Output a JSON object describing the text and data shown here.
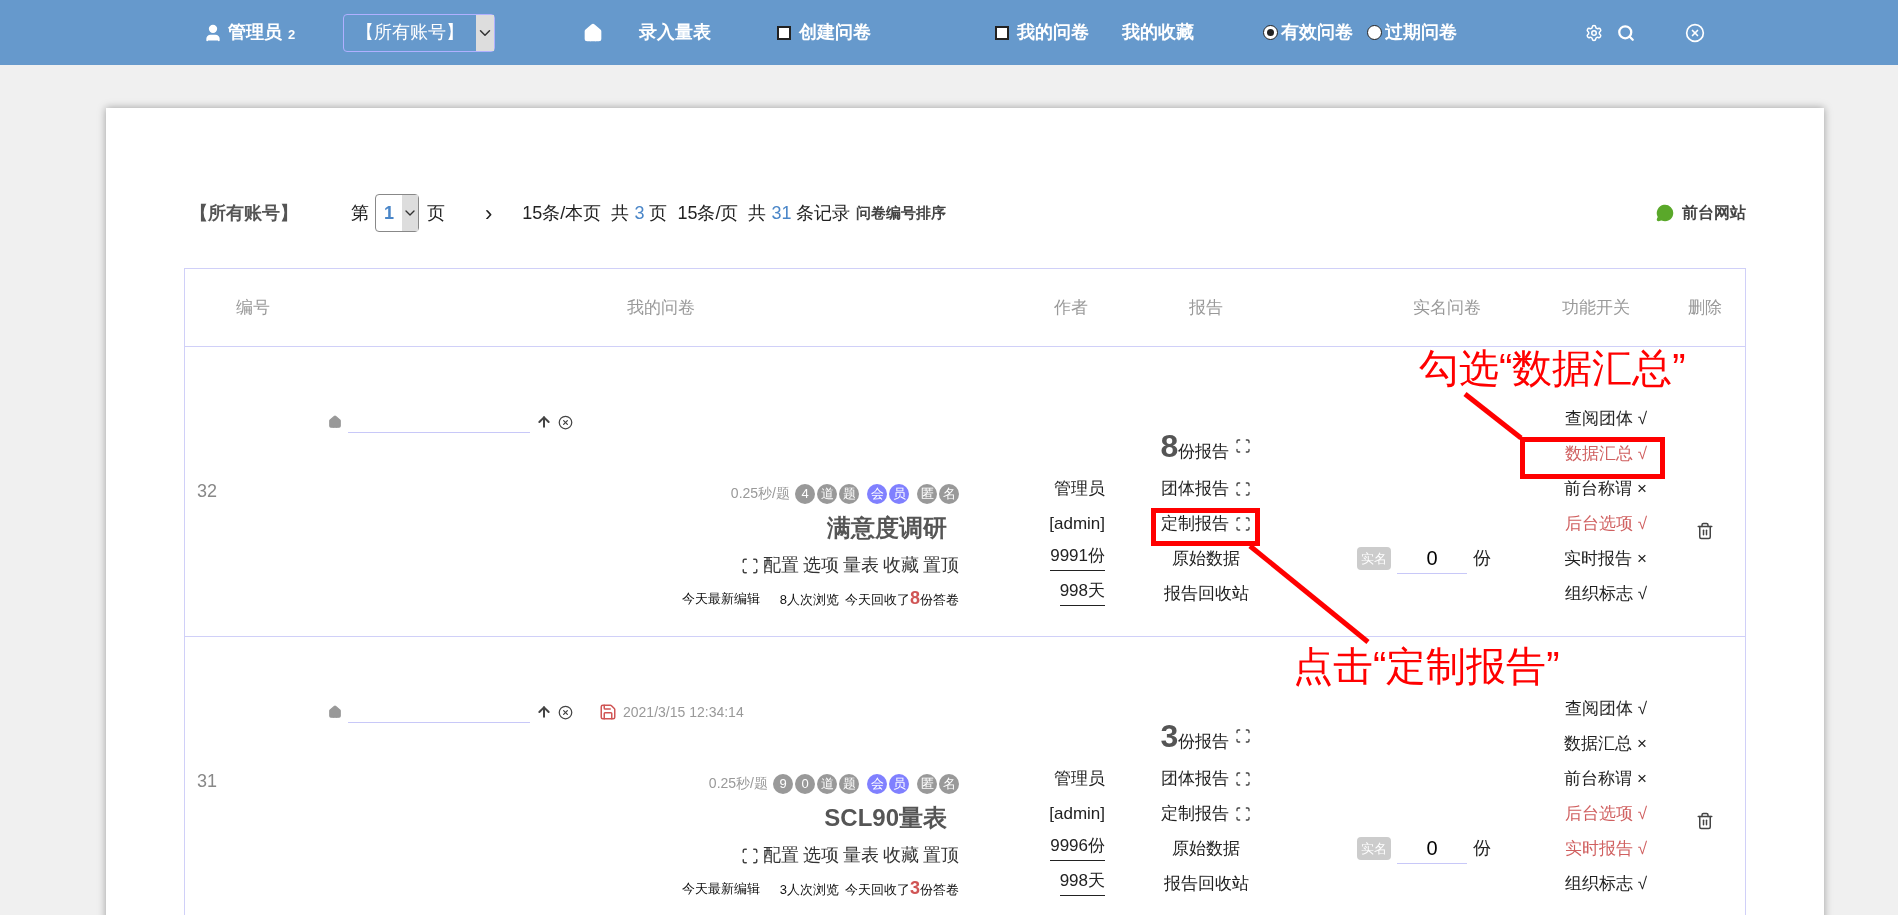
{
  "nav": {
    "user": {
      "name": "管理员",
      "count": "2"
    },
    "account_select": {
      "value": "【所有账号】"
    },
    "entry_link": "录入量表",
    "create": {
      "label": "创建问卷",
      "checked": false
    },
    "mine": {
      "label": "我的问卷",
      "checked": false
    },
    "favorites_link": "我的收藏",
    "status_radios": [
      {
        "label": "有效问卷",
        "selected": true
      },
      {
        "label": "过期问卷",
        "selected": false
      }
    ]
  },
  "toolbar": {
    "account": "【所有账号】",
    "page_prefix": "第",
    "page_value": "1",
    "page_suffix": "页",
    "next": "›",
    "summary": [
      {
        "text": "15条/本页  共 ",
        "accent": false
      },
      {
        "text": "3",
        "accent": true
      },
      {
        "text": " 页  15条/页  共 ",
        "accent": false
      },
      {
        "text": "31",
        "accent": true
      },
      {
        "text": " 条记录",
        "accent": false
      }
    ],
    "sort_link": "问卷编号排序",
    "site_link": "前台网站"
  },
  "table": {
    "columns": [
      "编号",
      "我的问卷",
      "作者",
      "报告",
      "实名问卷",
      "功能开关",
      "删除"
    ],
    "rows": [
      {
        "id": "32",
        "saved_at": null,
        "pace": "0.25秒/题",
        "badges": [
          {
            "text": "4",
            "color": "#999999"
          },
          {
            "text": "道",
            "color": "#999999"
          },
          {
            "text": "题",
            "color": "#999999"
          },
          {
            "text": "会",
            "color": "#8080ff"
          },
          {
            "text": "员",
            "color": "#8080ff"
          },
          {
            "text": "匿",
            "color": "#999999"
          },
          {
            "text": "名",
            "color": "#999999"
          }
        ],
        "title": "满意度调研",
        "actions": [
          "配置",
          "选项",
          "量表",
          "收藏",
          "置顶"
        ],
        "edited": "今天最新编辑",
        "views": "8人次浏览",
        "received": [
          "今天回收了",
          "8",
          "份答卷"
        ],
        "author": "管理员",
        "account": "[admin]",
        "quota": "9991份",
        "days": "998天",
        "report_count": "8",
        "report_label": "份报告",
        "reports": [
          {
            "label": "团体报告",
            "icon": true
          },
          {
            "label": "定制报告",
            "icon": true
          },
          {
            "label": "原始数据",
            "icon": false
          },
          {
            "label": "报告回收站",
            "icon": false
          }
        ],
        "realname_tag": "实名",
        "realname_value": "0",
        "realname_unit": "份",
        "switches": [
          {
            "label": "查阅团体",
            "mark": "√",
            "highlighted": false
          },
          {
            "label": "数据汇总",
            "mark": "√",
            "highlighted": true
          },
          {
            "label": "前台称谓",
            "mark": "×",
            "highlighted": false
          },
          {
            "label": "后台选项",
            "mark": "√",
            "highlighted": true
          },
          {
            "label": "实时报告",
            "mark": "×",
            "highlighted": false
          },
          {
            "label": "组织标志",
            "mark": "√",
            "highlighted": false
          }
        ]
      },
      {
        "id": "31",
        "saved_at": "2021/3/15 12:34:14",
        "pace": "0.25秒/题",
        "badges": [
          {
            "text": "9",
            "color": "#999999"
          },
          {
            "text": "0",
            "color": "#999999"
          },
          {
            "text": "道",
            "color": "#999999"
          },
          {
            "text": "题",
            "color": "#999999"
          },
          {
            "text": "会",
            "color": "#8080ff"
          },
          {
            "text": "员",
            "color": "#8080ff"
          },
          {
            "text": "匿",
            "color": "#999999"
          },
          {
            "text": "名",
            "color": "#999999"
          }
        ],
        "title": "SCL90量表",
        "actions": [
          "配置",
          "选项",
          "量表",
          "收藏",
          "置顶"
        ],
        "edited": "今天最新编辑",
        "views": "3人次浏览",
        "received": [
          "今天回收了",
          "3",
          "份答卷"
        ],
        "author": "管理员",
        "account": "[admin]",
        "quota": "9996份",
        "days": "998天",
        "report_count": "3",
        "report_label": "份报告",
        "reports": [
          {
            "label": "团体报告",
            "icon": true
          },
          {
            "label": "定制报告",
            "icon": true
          },
          {
            "label": "原始数据",
            "icon": false
          },
          {
            "label": "报告回收站",
            "icon": false
          }
        ],
        "realname_tag": "实名",
        "realname_value": "0",
        "realname_unit": "份",
        "switches": [
          {
            "label": "查阅团体",
            "mark": "√",
            "highlighted": false
          },
          {
            "label": "数据汇总",
            "mark": "×",
            "highlighted": false
          },
          {
            "label": "前台称谓",
            "mark": "×",
            "highlighted": false
          },
          {
            "label": "后台选项",
            "mark": "√",
            "highlighted": true
          },
          {
            "label": "实时报告",
            "mark": "√",
            "highlighted": true
          },
          {
            "label": "组织标志",
            "mark": "√",
            "highlighted": false
          }
        ]
      }
    ]
  },
  "annotations": [
    {
      "text": "勾选“数据汇总”"
    },
    {
      "text": "点击“定制报告”"
    }
  ]
}
